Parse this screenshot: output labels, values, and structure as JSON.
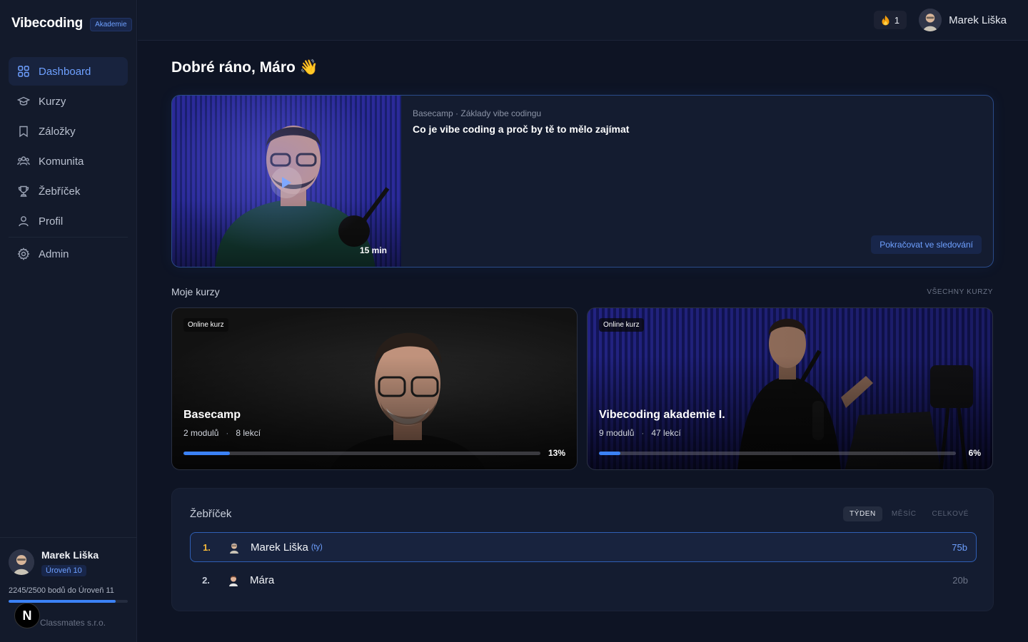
{
  "brand": {
    "name": "Vibecoding",
    "badge": "Akademie"
  },
  "nav": {
    "items": [
      {
        "label": "Dashboard",
        "icon": "grid-icon",
        "active": true
      },
      {
        "label": "Kurzy",
        "icon": "graduation-cap-icon"
      },
      {
        "label": "Záložky",
        "icon": "bookmark-icon"
      },
      {
        "label": "Komunita",
        "icon": "users-icon"
      },
      {
        "label": "Žebříček",
        "icon": "trophy-icon"
      },
      {
        "label": "Profil",
        "icon": "user-icon"
      }
    ],
    "admin": {
      "label": "Admin",
      "icon": "gear-icon"
    }
  },
  "sidebar_user": {
    "name": "Marek Liška",
    "level": "Úroveň 10",
    "points_text": "2245/2500 bodů do Úroveň 11",
    "progress": 0.898,
    "company": "Classmates s.r.o.",
    "bubble_letter": "N"
  },
  "topbar": {
    "streak_count": "1",
    "streak_icon": "fire-icon",
    "user_name": "Marek Liška"
  },
  "greeting": "Dobré ráno, Máro 👋",
  "hero": {
    "meta": "Basecamp · Základy vibe codingu",
    "title": "Co je vibe coding a proč by tě to mělo zajímat",
    "duration": "15 min",
    "continue_label": "Pokračovat ve sledování"
  },
  "courses_section": {
    "title": "Moje kurzy",
    "all_label": "VŠECHNY KURZY",
    "courses": [
      {
        "tag": "Online kurz",
        "name": "Basecamp",
        "modules": "2 modulů",
        "lessons": "8 lekcí",
        "percent_label": "13%",
        "progress": 0.13
      },
      {
        "tag": "Online kurz",
        "name": "Vibecoding akademie I.",
        "modules": "9 modulů",
        "lessons": "47 lekcí",
        "percent_label": "6%",
        "progress": 0.06
      }
    ]
  },
  "leaderboard": {
    "title": "Žebříček",
    "tabs": [
      "TÝDEN",
      "MĚSÍC",
      "CELKOVÉ"
    ],
    "active_tab": "TÝDEN",
    "rows": [
      {
        "rank": "1.",
        "name": "Marek Liška",
        "you": "(ty)",
        "points": "75b"
      },
      {
        "rank": "2.",
        "name": "Mára",
        "points": "20b"
      }
    ]
  },
  "colors": {
    "accent": "#3b82f6",
    "accent_text": "#6ea0ff",
    "background": "#0e1424",
    "card": "#141c30"
  }
}
